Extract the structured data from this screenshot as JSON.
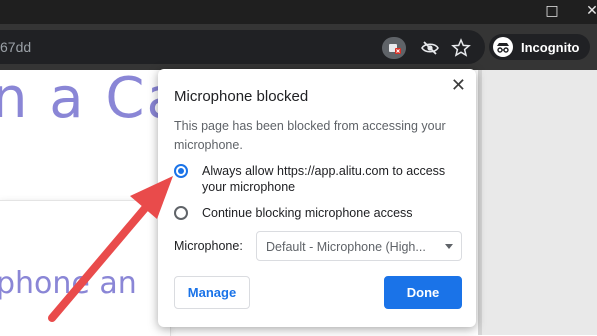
{
  "browser": {
    "window_controls": {
      "restore": "□",
      "close": "✕"
    },
    "url_fragment": "67dd",
    "icons": [
      "camera-blocked-icon",
      "eye-off-icon",
      "star-icon",
      "incognito-icon"
    ],
    "incognito_label": "Incognito"
  },
  "page": {
    "hero_text": "n a Ca",
    "sub_text": "phone an"
  },
  "popup": {
    "title": "Microphone blocked",
    "close": "✕",
    "description": "This page has been blocked from accessing your microphone.",
    "options": [
      {
        "label": "Always allow https://app.alitu.com to access your microphone",
        "selected": true
      },
      {
        "label": "Continue blocking microphone access",
        "selected": false
      }
    ],
    "microphone_label": "Microphone:",
    "microphone_select_value": "Default - Microphone (High...",
    "manage_label": "Manage",
    "done_label": "Done"
  },
  "colors": {
    "accent": "#1a73e8",
    "annotation_arrow": "#e94b4b",
    "hero_text": "#8a86d6"
  }
}
